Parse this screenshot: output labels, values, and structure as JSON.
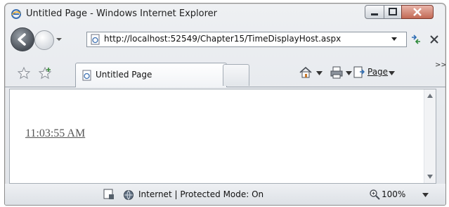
{
  "window": {
    "title": "Untitled Page - Windows Internet Explorer"
  },
  "address_bar": {
    "url": "http://localhost:52549/Chapter15/TimeDisplayHost.aspx"
  },
  "tabs": [
    {
      "label": "Untitled Page"
    }
  ],
  "command_bar": {
    "page_label": "Page",
    "more_label": ">>"
  },
  "content": {
    "time_text": "11:03:55 AM"
  },
  "status_bar": {
    "zone_text": "Internet | Protected Mode: On",
    "zoom": "100%"
  }
}
